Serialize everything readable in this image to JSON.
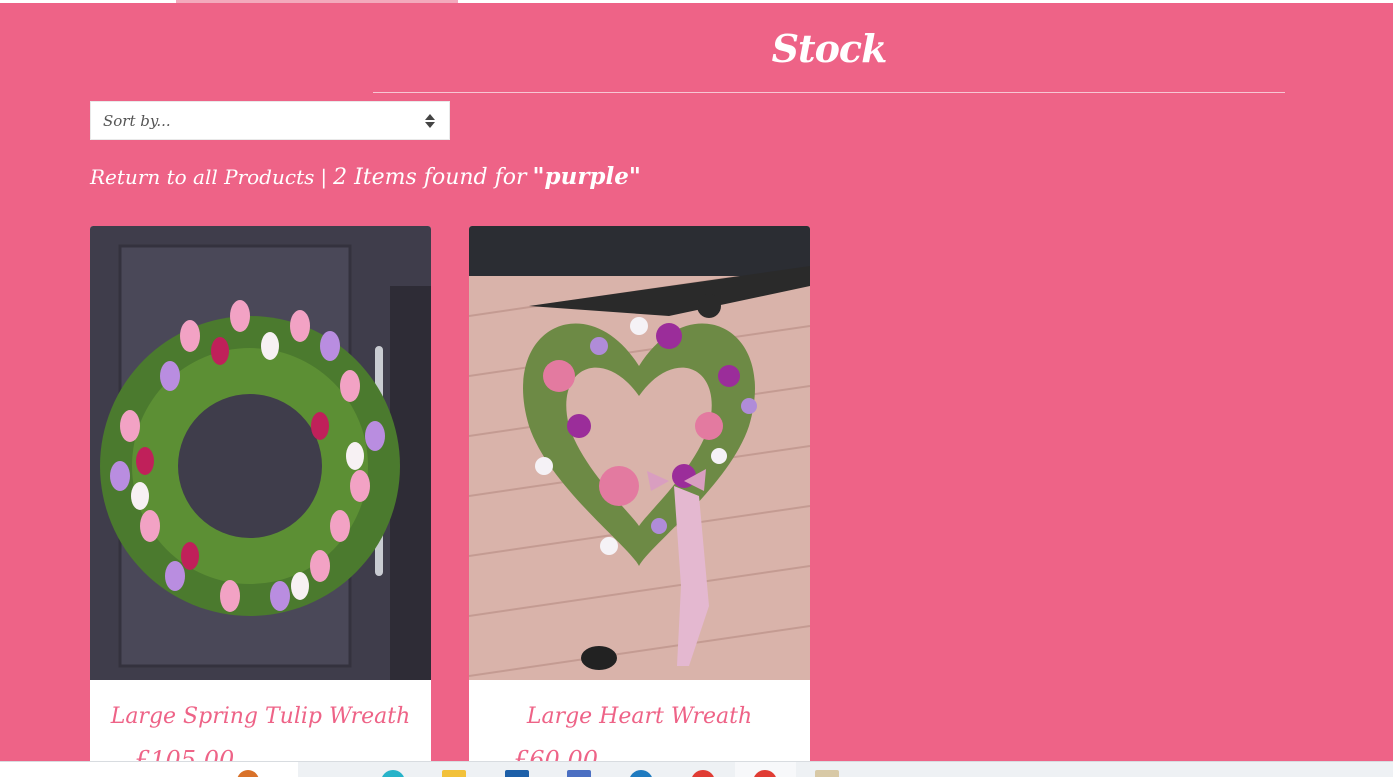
{
  "page": {
    "title": "Stock",
    "accent_color": "#ee6387"
  },
  "sort": {
    "selected": "Sort by..."
  },
  "results": {
    "return_link": "Return to all Products",
    "separator": "|",
    "count_text": "2 Items found for",
    "query": "\"purple\""
  },
  "products": [
    {
      "name": "Large Spring Tulip Wreath",
      "price": "£105.00"
    },
    {
      "name": "Large Heart Wreath",
      "price": "£60.00"
    }
  ],
  "taskbar": {
    "icons": [
      "pumpkin-icon",
      "edge-icon",
      "file-explorer-icon",
      "app-icon-blue",
      "app-icon-stack",
      "app-icon-circle-blue",
      "app-icon-red",
      "app-icon-red-active",
      "app-icon-folder"
    ]
  }
}
